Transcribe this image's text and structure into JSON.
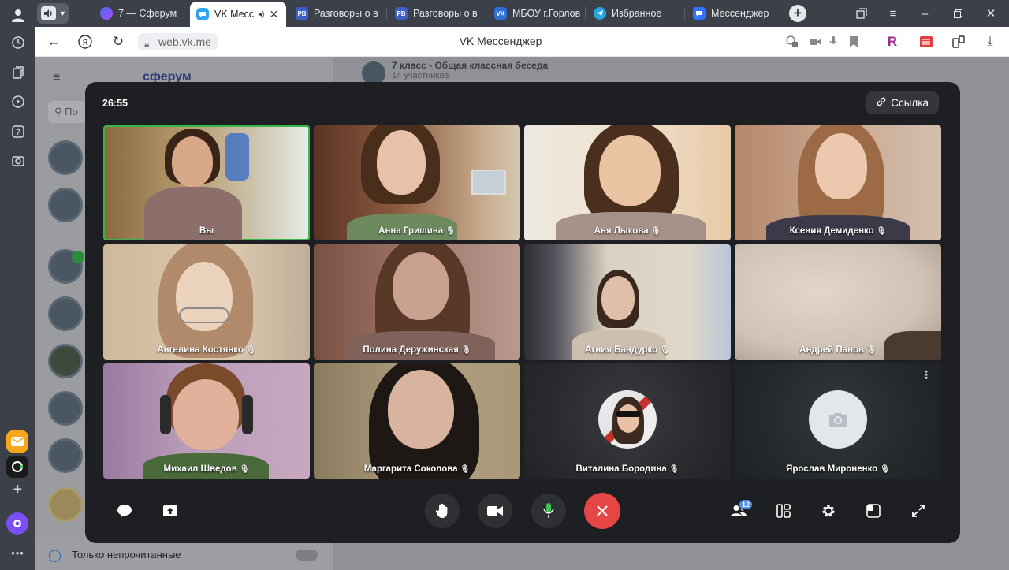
{
  "browser": {
    "tabs": [
      {
        "label": "7 — Сферум",
        "favicon_color": "#5b5bf5"
      },
      {
        "label": "VK Месс",
        "favicon_color": "#2fa6f0"
      },
      {
        "label": "Разговоры о в",
        "favicon_color": "#3b5fc7",
        "favicon_text": "РВ"
      },
      {
        "label": "Разговоры о в",
        "favicon_color": "#3b5fc7",
        "favicon_text": "РВ"
      },
      {
        "label": "МБОУ г.Горлов",
        "favicon_color": "#2f6fd8",
        "favicon_text": "VK"
      },
      {
        "label": "Избранное",
        "favicon_color": "#2aa3e0"
      },
      {
        "label": "Мессенджер",
        "favicon_color": "#2f73ff"
      }
    ],
    "url": "web.vk.me",
    "page_title": "VK Мессенджер"
  },
  "background_page": {
    "chat_title": "7 класс - Общая классная беседа",
    "chat_subtitle": "14 участников",
    "logo": "сферум",
    "search_placeholder": "По",
    "filter_label": "Только непрочитанные"
  },
  "call": {
    "timer": "26:55",
    "link_label": "Ссылка",
    "participants_count": "12",
    "participants": [
      {
        "name": "Вы",
        "muted": false,
        "self": true
      },
      {
        "name": "Анна Гришина",
        "muted": true
      },
      {
        "name": "Аня Лыкова",
        "muted": true
      },
      {
        "name": "Ксения Демиденко",
        "muted": true
      },
      {
        "name": "Ангелина Костянко",
        "muted": true
      },
      {
        "name": "Полина Деружинская",
        "muted": true
      },
      {
        "name": "Агния Бандурко",
        "muted": true
      },
      {
        "name": "Андрей Панов",
        "muted": true
      },
      {
        "name": "Михаил Шведов",
        "muted": true
      },
      {
        "name": "Маргарита Соколова",
        "muted": true
      },
      {
        "name": "Виталина Бородина",
        "muted": true
      },
      {
        "name": "Ярослав Мироненко",
        "muted": true
      }
    ]
  },
  "colors": {
    "accent_green": "#37b64a",
    "hangup_red": "#e64646",
    "badge_blue": "#4a8ee8",
    "modal_bg": "#1e1f22"
  }
}
